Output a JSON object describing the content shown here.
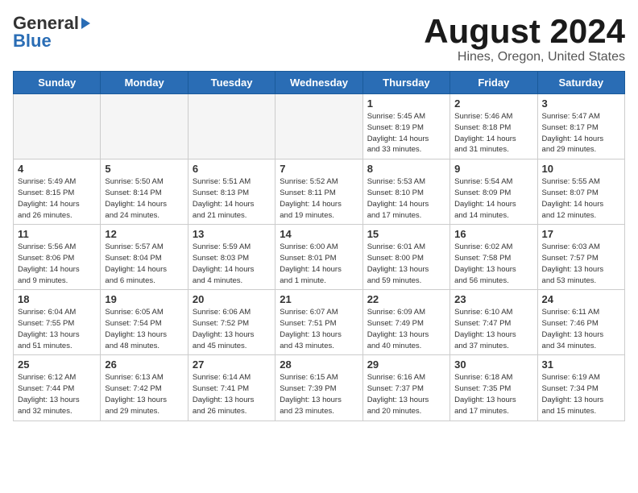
{
  "header": {
    "logo_general": "General",
    "logo_blue": "Blue",
    "title": "August 2024",
    "subtitle": "Hines, Oregon, United States"
  },
  "days_of_week": [
    "Sunday",
    "Monday",
    "Tuesday",
    "Wednesday",
    "Thursday",
    "Friday",
    "Saturday"
  ],
  "weeks": [
    [
      {
        "day": "",
        "info": ""
      },
      {
        "day": "",
        "info": ""
      },
      {
        "day": "",
        "info": ""
      },
      {
        "day": "",
        "info": ""
      },
      {
        "day": "1",
        "info": "Sunrise: 5:45 AM\nSunset: 8:19 PM\nDaylight: 14 hours\nand 33 minutes."
      },
      {
        "day": "2",
        "info": "Sunrise: 5:46 AM\nSunset: 8:18 PM\nDaylight: 14 hours\nand 31 minutes."
      },
      {
        "day": "3",
        "info": "Sunrise: 5:47 AM\nSunset: 8:17 PM\nDaylight: 14 hours\nand 29 minutes."
      }
    ],
    [
      {
        "day": "4",
        "info": "Sunrise: 5:49 AM\nSunset: 8:15 PM\nDaylight: 14 hours\nand 26 minutes."
      },
      {
        "day": "5",
        "info": "Sunrise: 5:50 AM\nSunset: 8:14 PM\nDaylight: 14 hours\nand 24 minutes."
      },
      {
        "day": "6",
        "info": "Sunrise: 5:51 AM\nSunset: 8:13 PM\nDaylight: 14 hours\nand 21 minutes."
      },
      {
        "day": "7",
        "info": "Sunrise: 5:52 AM\nSunset: 8:11 PM\nDaylight: 14 hours\nand 19 minutes."
      },
      {
        "day": "8",
        "info": "Sunrise: 5:53 AM\nSunset: 8:10 PM\nDaylight: 14 hours\nand 17 minutes."
      },
      {
        "day": "9",
        "info": "Sunrise: 5:54 AM\nSunset: 8:09 PM\nDaylight: 14 hours\nand 14 minutes."
      },
      {
        "day": "10",
        "info": "Sunrise: 5:55 AM\nSunset: 8:07 PM\nDaylight: 14 hours\nand 12 minutes."
      }
    ],
    [
      {
        "day": "11",
        "info": "Sunrise: 5:56 AM\nSunset: 8:06 PM\nDaylight: 14 hours\nand 9 minutes."
      },
      {
        "day": "12",
        "info": "Sunrise: 5:57 AM\nSunset: 8:04 PM\nDaylight: 14 hours\nand 6 minutes."
      },
      {
        "day": "13",
        "info": "Sunrise: 5:59 AM\nSunset: 8:03 PM\nDaylight: 14 hours\nand 4 minutes."
      },
      {
        "day": "14",
        "info": "Sunrise: 6:00 AM\nSunset: 8:01 PM\nDaylight: 14 hours\nand 1 minute."
      },
      {
        "day": "15",
        "info": "Sunrise: 6:01 AM\nSunset: 8:00 PM\nDaylight: 13 hours\nand 59 minutes."
      },
      {
        "day": "16",
        "info": "Sunrise: 6:02 AM\nSunset: 7:58 PM\nDaylight: 13 hours\nand 56 minutes."
      },
      {
        "day": "17",
        "info": "Sunrise: 6:03 AM\nSunset: 7:57 PM\nDaylight: 13 hours\nand 53 minutes."
      }
    ],
    [
      {
        "day": "18",
        "info": "Sunrise: 6:04 AM\nSunset: 7:55 PM\nDaylight: 13 hours\nand 51 minutes."
      },
      {
        "day": "19",
        "info": "Sunrise: 6:05 AM\nSunset: 7:54 PM\nDaylight: 13 hours\nand 48 minutes."
      },
      {
        "day": "20",
        "info": "Sunrise: 6:06 AM\nSunset: 7:52 PM\nDaylight: 13 hours\nand 45 minutes."
      },
      {
        "day": "21",
        "info": "Sunrise: 6:07 AM\nSunset: 7:51 PM\nDaylight: 13 hours\nand 43 minutes."
      },
      {
        "day": "22",
        "info": "Sunrise: 6:09 AM\nSunset: 7:49 PM\nDaylight: 13 hours\nand 40 minutes."
      },
      {
        "day": "23",
        "info": "Sunrise: 6:10 AM\nSunset: 7:47 PM\nDaylight: 13 hours\nand 37 minutes."
      },
      {
        "day": "24",
        "info": "Sunrise: 6:11 AM\nSunset: 7:46 PM\nDaylight: 13 hours\nand 34 minutes."
      }
    ],
    [
      {
        "day": "25",
        "info": "Sunrise: 6:12 AM\nSunset: 7:44 PM\nDaylight: 13 hours\nand 32 minutes."
      },
      {
        "day": "26",
        "info": "Sunrise: 6:13 AM\nSunset: 7:42 PM\nDaylight: 13 hours\nand 29 minutes."
      },
      {
        "day": "27",
        "info": "Sunrise: 6:14 AM\nSunset: 7:41 PM\nDaylight: 13 hours\nand 26 minutes."
      },
      {
        "day": "28",
        "info": "Sunrise: 6:15 AM\nSunset: 7:39 PM\nDaylight: 13 hours\nand 23 minutes."
      },
      {
        "day": "29",
        "info": "Sunrise: 6:16 AM\nSunset: 7:37 PM\nDaylight: 13 hours\nand 20 minutes."
      },
      {
        "day": "30",
        "info": "Sunrise: 6:18 AM\nSunset: 7:35 PM\nDaylight: 13 hours\nand 17 minutes."
      },
      {
        "day": "31",
        "info": "Sunrise: 6:19 AM\nSunset: 7:34 PM\nDaylight: 13 hours\nand 15 minutes."
      }
    ]
  ]
}
